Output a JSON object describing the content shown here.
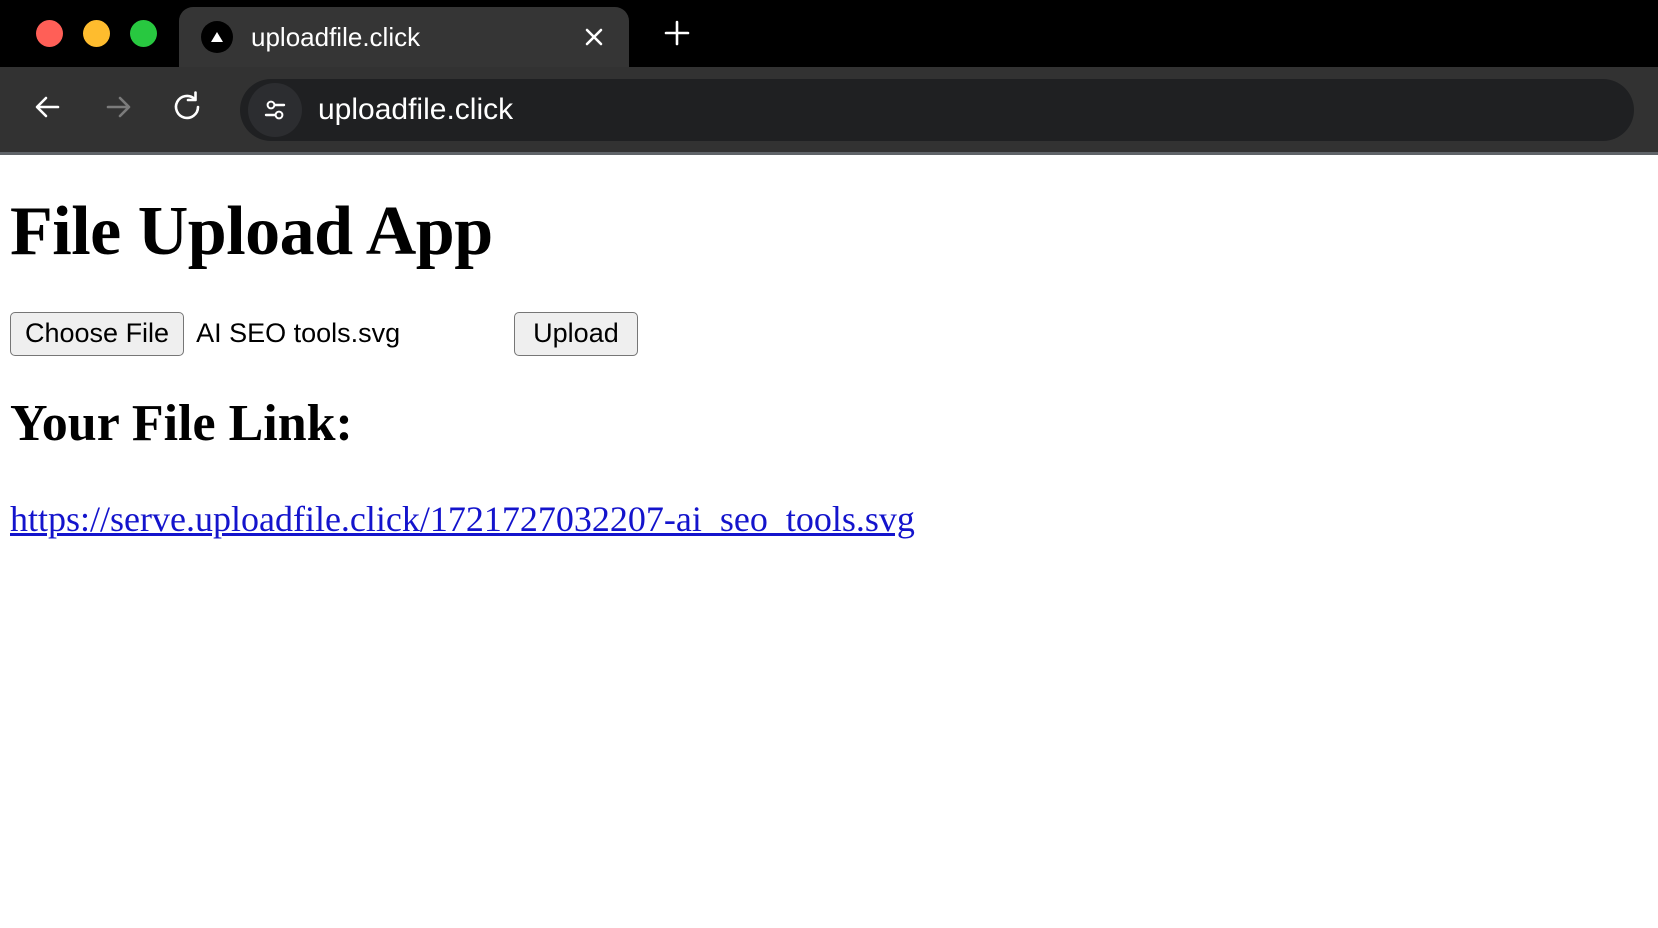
{
  "window": {
    "traffic_lights": [
      {
        "name": "close",
        "color": "#ff5f57"
      },
      {
        "name": "minimize",
        "color": "#febc2e"
      },
      {
        "name": "maximize",
        "color": "#28c840"
      }
    ]
  },
  "tabstrip": {
    "tab": {
      "title": "uploadfile.click",
      "favicon_icon": "upload-triangle-icon",
      "close_icon": "close-icon"
    },
    "new_tab_icon": "plus-icon"
  },
  "toolbar": {
    "back_icon": "arrow-left-icon",
    "forward_icon": "arrow-right-icon",
    "reload_icon": "reload-icon",
    "site_settings_icon": "tune-sliders-icon",
    "url": "uploadfile.click"
  },
  "page": {
    "heading": "File Upload App",
    "form": {
      "choose_file_label": "Choose File",
      "selected_file_name": "AI SEO tools.svg",
      "upload_label": "Upload"
    },
    "result": {
      "heading": "Your File Link:",
      "link_text": "https://serve.uploadfile.click/1721727032207-ai_seo_tools.svg",
      "link_color": "#1414cc"
    }
  }
}
